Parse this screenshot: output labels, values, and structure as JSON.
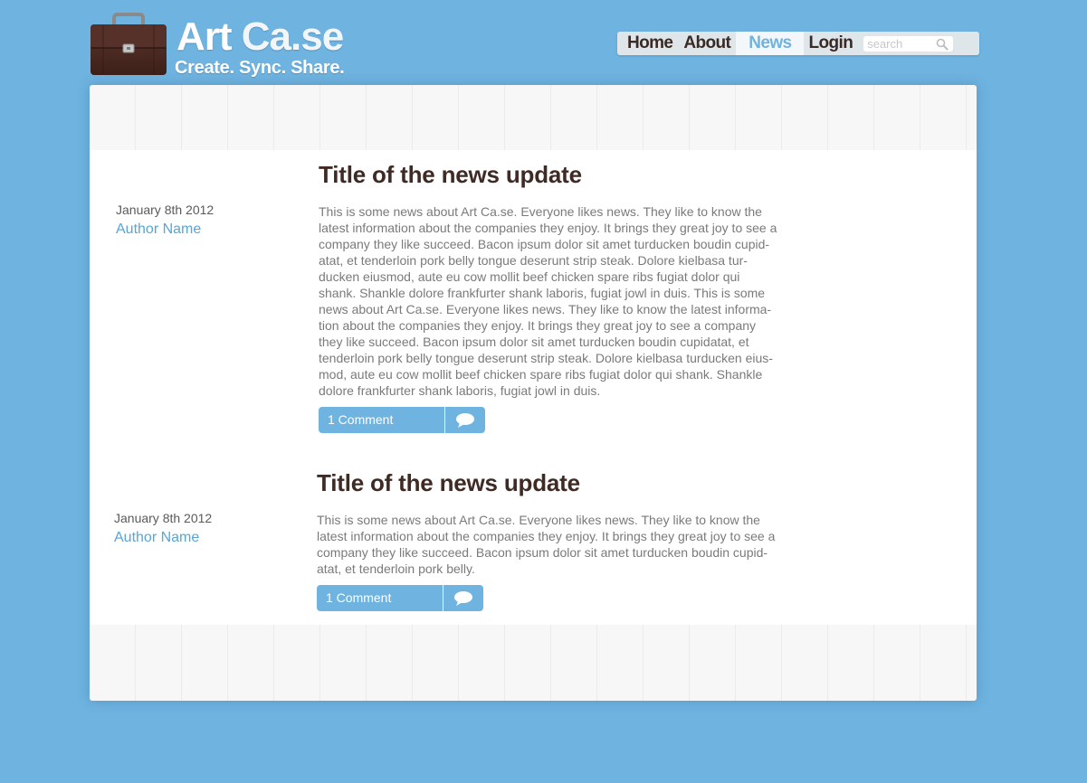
{
  "logo": {
    "title_main": "Art ",
    "title_accent": "Ca.se",
    "tagline": "Create. Sync. Share.",
    "icon": "briefcase-icon"
  },
  "nav": {
    "items": [
      {
        "label": "Home"
      },
      {
        "label": "About"
      },
      {
        "label": "News",
        "active": true
      },
      {
        "label": "Login"
      }
    ],
    "search": {
      "placeholder": "search",
      "value": "",
      "icon": "search-icon"
    }
  },
  "posts": [
    {
      "date": "January 8th 2012",
      "author": "Author Name",
      "title": "Title of the news update",
      "lines": [
        "This is some news about Art Ca.se.  Everyone likes news.  They like to know the",
        "latest information about the companies they enjoy.  It brings they great joy to see a",
        "company they like succeed.  Bacon ipsum dolor sit amet turducken boudin cupid-",
        "atat, et tenderloin pork belly tongue deserunt strip steak. Dolore kielbasa tur-",
        "ducken eiusmod, aute eu cow mollit beef chicken spare ribs fugiat dolor qui",
        "shank. Shankle dolore frankfurter shank laboris, fugiat jowl in duis.  This is some",
        "news about Art Ca.se.  Everyone likes news.  They like to know the latest informa-",
        "tion about the companies they enjoy.  It brings they great joy to see a company",
        "they like succeed.  Bacon ipsum dolor sit amet turducken boudin cupidatat, et",
        "tenderloin pork belly tongue deserunt strip steak. Dolore kielbasa turducken eius-",
        "mod, aute eu cow mollit beef chicken spare ribs fugiat dolor qui shank. Shankle",
        "dolore frankfurter shank laboris, fugiat jowl in duis."
      ],
      "comment_label": "1 Comment"
    },
    {
      "date": "January 8th 2012",
      "author": "Author Name",
      "title": "Title of the news update",
      "lines": [
        "This is some news about Art Ca.se.  Everyone likes news.  They like to know the",
        "latest information about the companies they enjoy.  It brings they great joy to see a",
        "company they like succeed.  Bacon ipsum dolor sit amet turducken boudin cupid-",
        "atat, et tenderloin pork belly."
      ],
      "comment_label": "1 Comment"
    }
  ],
  "colors": {
    "background": "#6fb3e0",
    "accent": "#6fb3e0",
    "title": "#3f2a24",
    "body_text": "#7a7a7a",
    "briefcase": "#4a2a22"
  }
}
